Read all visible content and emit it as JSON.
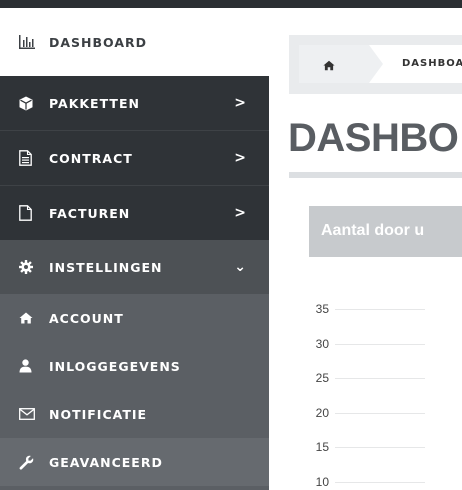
{
  "sidebar": {
    "items": [
      {
        "label": "DASHBOARD",
        "icon": "bar-chart-icon"
      },
      {
        "label": "PAKKETTEN",
        "icon": "cube-icon",
        "expand": ">"
      },
      {
        "label": "CONTRACT",
        "icon": "document-icon",
        "expand": ">"
      },
      {
        "label": "FACTUREN",
        "icon": "file-icon",
        "expand": ">"
      },
      {
        "label": "INSTELLINGEN",
        "icon": "gear-icon",
        "expand": "⌄"
      }
    ],
    "subitems": [
      {
        "label": "ACCOUNT",
        "icon": "home-icon"
      },
      {
        "label": "INLOGGEGEVENS",
        "icon": "user-icon"
      },
      {
        "label": "NOTIFICATIE",
        "icon": "envelope-icon"
      },
      {
        "label": "GEAVANCEERD",
        "icon": "wrench-icon"
      }
    ],
    "colors": {
      "dark": "#2f3337",
      "open": "#4d5155",
      "sub": "#5b5f64",
      "active": "#666a6f"
    }
  },
  "breadcrumb": {
    "home_icon": "home-icon",
    "current": "DASHBOA"
  },
  "page_title": "DASHBO",
  "panel": {
    "title": "Aantal door u"
  },
  "chart_data": {
    "type": "line",
    "title": "Aantal door u",
    "xlabel": "",
    "ylabel": "",
    "y_ticks": [
      "35",
      "30",
      "25",
      "20",
      "15",
      "10"
    ],
    "ylim": [
      10,
      35
    ],
    "grid": true,
    "series": []
  }
}
